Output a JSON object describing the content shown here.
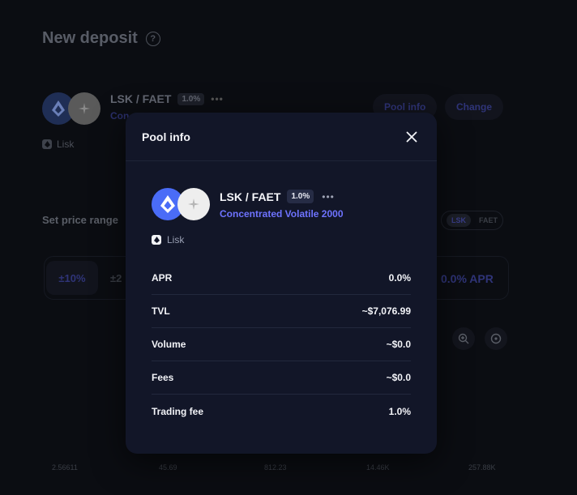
{
  "background": {
    "title": "New deposit",
    "pair": {
      "name": "LSK / FAET",
      "fee": "1.0%",
      "subtitle": "Con"
    },
    "chain": "Lisk",
    "buttons": {
      "pool_info": "Pool info",
      "change": "Change"
    },
    "range_label": "Set price range",
    "toggle": {
      "left": "LSK",
      "right": "FAET"
    },
    "range_pills": [
      "±10%",
      "±2"
    ],
    "apr": "0.0% APR",
    "axis_labels": [
      "2.56611",
      "45.69",
      "812.23",
      "14.46K",
      "257.88K"
    ]
  },
  "modal": {
    "title": "Pool info",
    "pair": {
      "name": "LSK / FAET",
      "fee": "1.0%",
      "type": "Concentrated Volatile 2000"
    },
    "chain": "Lisk",
    "stats": [
      {
        "label": "APR",
        "value": "0.0%"
      },
      {
        "label": "TVL",
        "value": "~$7,076.99"
      },
      {
        "label": "Volume",
        "value": "~$0.0"
      },
      {
        "label": "Fees",
        "value": "~$0.0"
      },
      {
        "label": "Trading fee",
        "value": "1.0%"
      }
    ]
  },
  "colors": {
    "accent": "#6e73ff",
    "lsk_token": "#4a6cf7",
    "modal_bg": "#121628",
    "page_bg": "#0b0d12"
  },
  "icons": {
    "close": "close-icon",
    "lsk": "lisk-token-icon",
    "faet": "faet-token-icon",
    "chain": "lisk-chain-icon",
    "more": "more-dots-icon"
  }
}
